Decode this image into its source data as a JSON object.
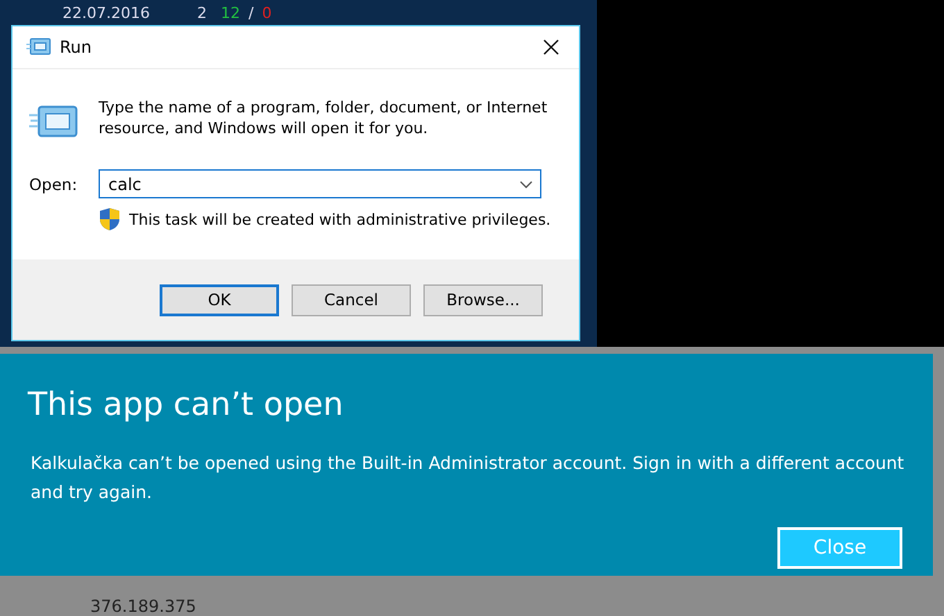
{
  "background_table": {
    "row": {
      "date": "22.07.2016",
      "count": "2",
      "passed": "12",
      "separator": "/",
      "failed": "0"
    },
    "footer_number": "376.189.375"
  },
  "run_dialog": {
    "title": "Run",
    "description": "Type the name of a program, folder, document, or Internet resource, and Windows will open it for you.",
    "open_label": "Open:",
    "open_value": "calc",
    "admin_note": "This task will be created with administrative privileges.",
    "buttons": [
      {
        "label": "OK",
        "default": true
      },
      {
        "label": "Cancel",
        "default": false
      },
      {
        "label": "Browse...",
        "default": false
      }
    ]
  },
  "error_banner": {
    "title": "This app can’t open",
    "message": "Kalkulačka can’t be opened using the Built-in Administrator account. Sign in with a different account and try again.",
    "button": "Close"
  }
}
